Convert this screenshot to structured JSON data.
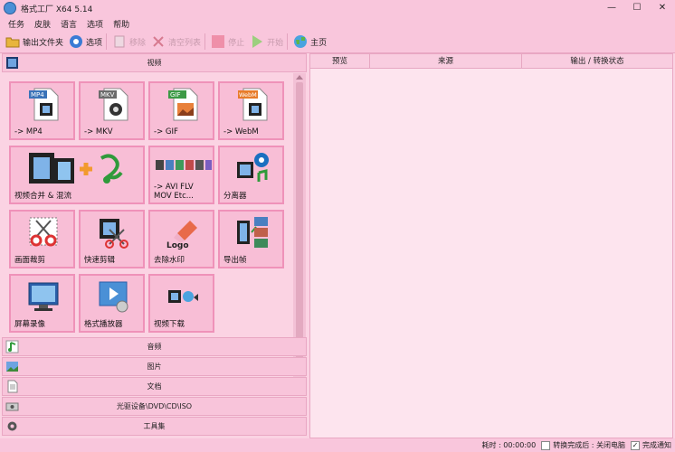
{
  "window": {
    "title": "格式工厂 X64 5.14",
    "min": "—",
    "max": "☐",
    "close": "✕"
  },
  "menu": [
    "任务",
    "皮肤",
    "语言",
    "选项",
    "帮助"
  ],
  "toolbar": {
    "output_folder": "输出文件夹",
    "options": "选项",
    "remove": "移除",
    "clear_list": "清空列表",
    "stop": "停止",
    "start": "开始",
    "home": "主页"
  },
  "categories": {
    "video": "视频",
    "audio": "音频",
    "image": "图片",
    "document": "文档",
    "disc": "光驱设备\\DVD\\CD\\ISO",
    "tools": "工具集"
  },
  "tiles": [
    {
      "label": "-> MP4",
      "badge": "MP4"
    },
    {
      "label": "-> MKV",
      "badge": "MKV"
    },
    {
      "label": "-> GIF",
      "badge": "GIF"
    },
    {
      "label": "-> WebM",
      "badge": "WebM"
    },
    {
      "label": "视频合并 & 混流"
    },
    {
      "label": "-> AVI FLV\nMOV Etc..."
    },
    {
      "label": "分离器"
    },
    {
      "label": "画面裁剪"
    },
    {
      "label": "快速剪辑"
    },
    {
      "label": "去除水印",
      "logo": "Logo"
    },
    {
      "label": "导出帧"
    },
    {
      "label": "屏幕录像"
    },
    {
      "label": "格式播放器"
    },
    {
      "label": "视频下载"
    }
  ],
  "task_table": {
    "columns": [
      "预览",
      "来源",
      "输出 / 转换状态"
    ]
  },
  "status": {
    "elapsed_label": "耗时 : 00:00:00",
    "after_done": "转换完成后 : 关闭电脑",
    "notify": "完成通知",
    "notify_checked": true,
    "after_done_checked": false
  },
  "colors": {
    "accent": "#ef92b9",
    "background": "#fbd3e3"
  }
}
